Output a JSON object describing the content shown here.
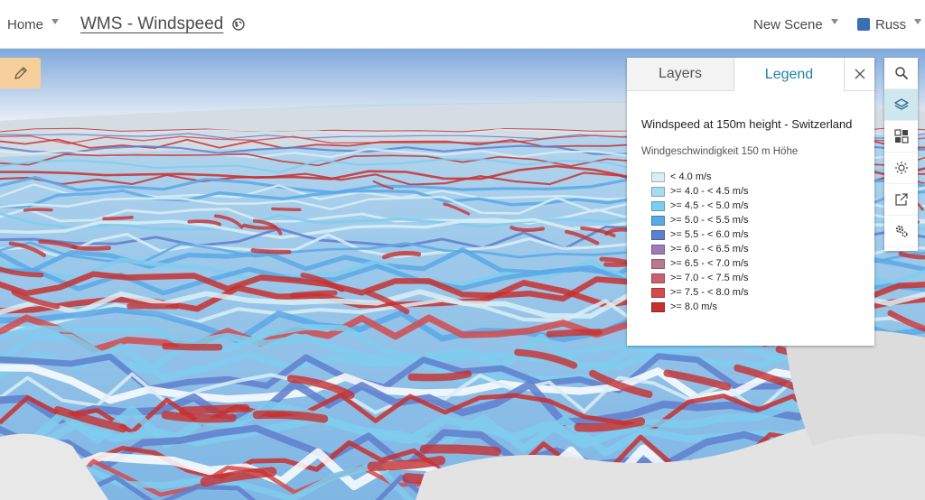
{
  "header": {
    "home_label": "Home",
    "app_title": "WMS - Windspeed",
    "new_scene_label": "New Scene",
    "user_name": "Russ"
  },
  "panel": {
    "tabs": [
      {
        "label": "Layers",
        "active": false
      },
      {
        "label": "Legend",
        "active": true
      }
    ],
    "close_icon": "close-icon",
    "service_title": "Windspeed at 150m height - Switzerland",
    "layer_title": "Windgeschwindigkeit 150 m Höhe",
    "legend": [
      {
        "label": "< 4.0 m/s",
        "color": "#d9eef4"
      },
      {
        "label": ">= 4.0 - < 4.5 m/s",
        "color": "#a6dcef"
      },
      {
        "label": ">= 4.5 - < 5.0 m/s",
        "color": "#7fcdee"
      },
      {
        "label": ">= 5.0 - < 5.5 m/s",
        "color": "#5aa8e6"
      },
      {
        "label": ">= 5.5 - < 6.0 m/s",
        "color": "#5f7fcc"
      },
      {
        "label": ">= 6.0 - < 6.5 m/s",
        "color": "#9d7bb6"
      },
      {
        "label": ">= 6.5 - < 7.0 m/s",
        "color": "#b77a91"
      },
      {
        "label": ">= 7.0 - < 7.5 m/s",
        "color": "#c9606f"
      },
      {
        "label": ">= 7.5 - < 8.0 m/s",
        "color": "#d44a4c"
      },
      {
        "label": ">= 8.0 m/s",
        "color": "#c8302f"
      }
    ]
  },
  "toolbar": [
    {
      "icon": "search-icon",
      "active": false
    },
    {
      "icon": "layers-icon",
      "active": true
    },
    {
      "icon": "basemap-gallery-icon",
      "active": false
    },
    {
      "icon": "daylight-icon",
      "active": false
    },
    {
      "icon": "share-icon",
      "active": false
    },
    {
      "icon": "settings-icon",
      "active": false
    }
  ],
  "colors": {
    "accent": "#2184a4",
    "edit_button": "#f6cf9b",
    "toolbar_active": "#cfe8ef"
  }
}
